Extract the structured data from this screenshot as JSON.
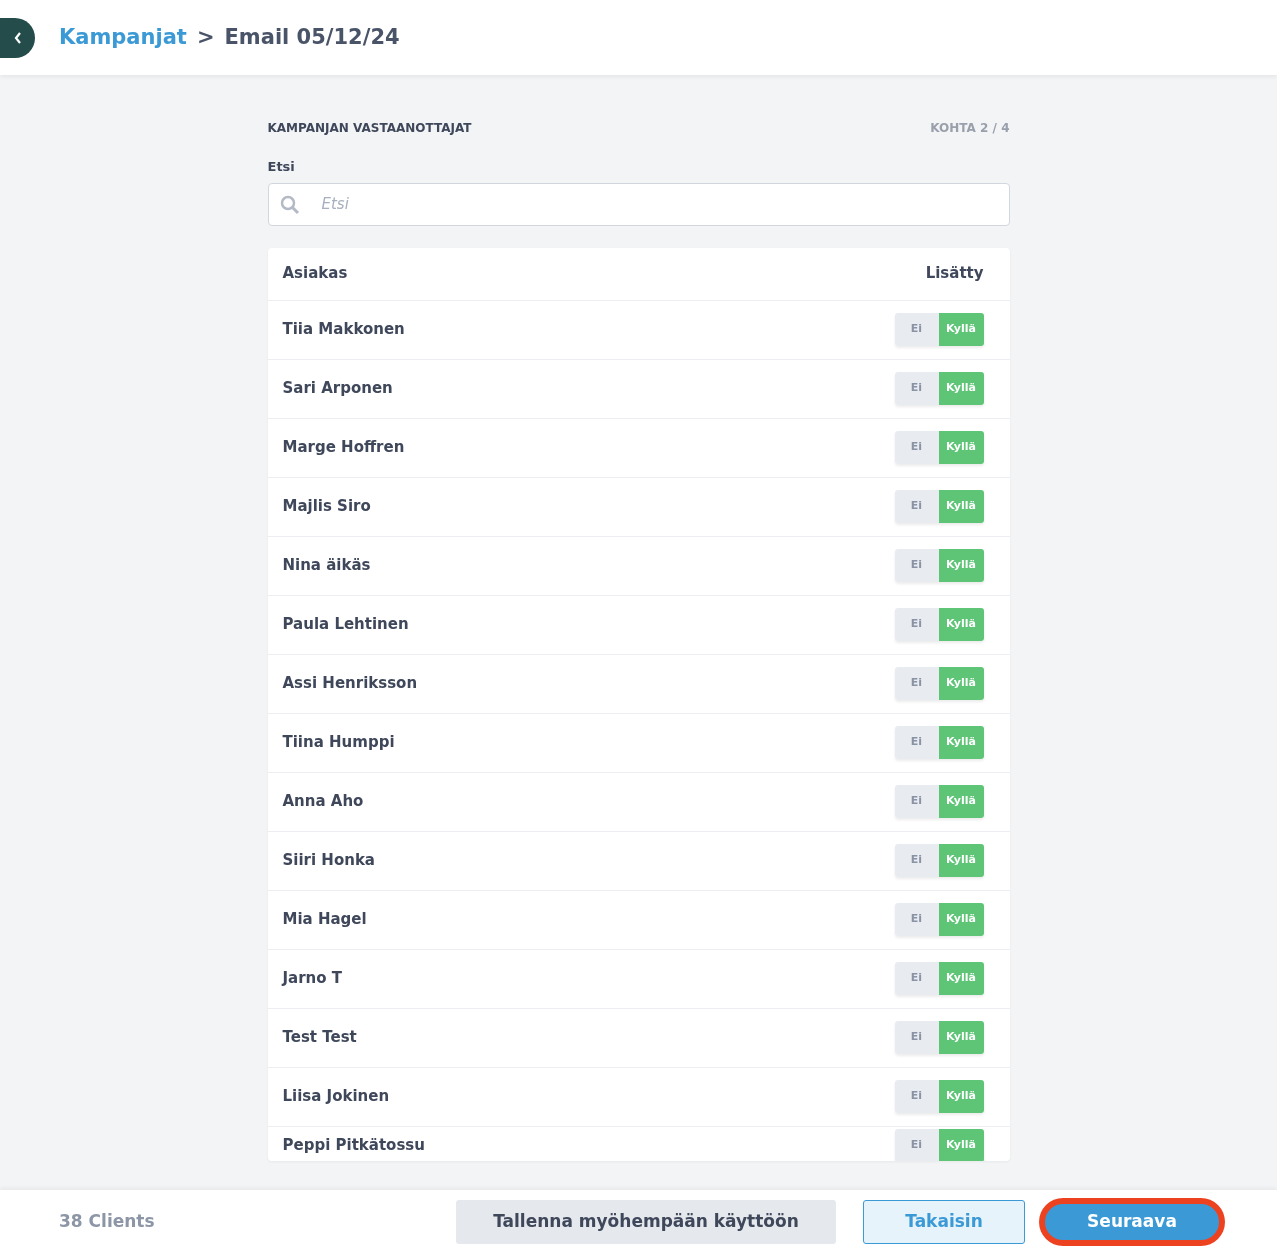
{
  "breadcrumb": {
    "parent": "Kampanjat",
    "separator": ">",
    "current": "Email 05/12/24"
  },
  "section": {
    "title": "KAMPANJAN VASTAANOTTAJAT",
    "step": "KOHTA 2 / 4"
  },
  "search": {
    "label": "Etsi",
    "placeholder": "Etsi"
  },
  "table": {
    "columns": [
      "Asiakas",
      "Lisätty"
    ],
    "rows": [
      {
        "name": "Tiia Makkonen",
        "no": "Ei",
        "yes": "Kyllä",
        "added": true
      },
      {
        "name": "Sari Arponen",
        "no": "Ei",
        "yes": "Kyllä",
        "added": true
      },
      {
        "name": "Marge Hoffren",
        "no": "Ei",
        "yes": "Kyllä",
        "added": true
      },
      {
        "name": "Majlis Siro",
        "no": "Ei",
        "yes": "Kyllä",
        "added": true
      },
      {
        "name": "Nina äikäs",
        "no": "Ei",
        "yes": "Kyllä",
        "added": true
      },
      {
        "name": "Paula Lehtinen",
        "no": "Ei",
        "yes": "Kyllä",
        "added": true
      },
      {
        "name": "Assi Henriksson",
        "no": "Ei",
        "yes": "Kyllä",
        "added": true
      },
      {
        "name": "Tiina Humppi",
        "no": "Ei",
        "yes": "Kyllä",
        "added": true
      },
      {
        "name": "Anna Aho",
        "no": "Ei",
        "yes": "Kyllä",
        "added": true
      },
      {
        "name": "Siiri Honka",
        "no": "Ei",
        "yes": "Kyllä",
        "added": true
      },
      {
        "name": "Mia Hagel",
        "no": "Ei",
        "yes": "Kyllä",
        "added": true
      },
      {
        "name": "Jarno T",
        "no": "Ei",
        "yes": "Kyllä",
        "added": true
      },
      {
        "name": "Test Test",
        "no": "Ei",
        "yes": "Kyllä",
        "added": true
      },
      {
        "name": "Liisa Jokinen",
        "no": "Ei",
        "yes": "Kyllä",
        "added": true
      },
      {
        "name": "Peppi Pitkätossu",
        "no": "Ei",
        "yes": "Kyllä",
        "added": true
      }
    ]
  },
  "footer": {
    "count": "38 Clients",
    "buttons": [
      {
        "kind": "secondary",
        "label": "Tallenna myöhempään käyttöön",
        "focused": false
      },
      {
        "kind": "outline",
        "label": "Takaisin",
        "focused": false
      },
      {
        "kind": "primary",
        "label": "Seuraava",
        "focused": true
      }
    ]
  }
}
